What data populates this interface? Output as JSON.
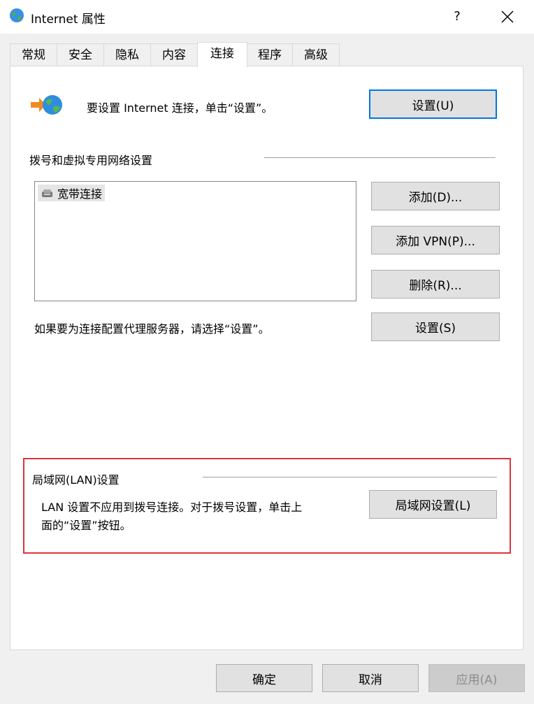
{
  "window": {
    "title": "Internet 属性",
    "help_label": "?",
    "icon": "globe-icon",
    "close_icon": "close-icon"
  },
  "tabs": [
    {
      "label": "常规"
    },
    {
      "label": "安全"
    },
    {
      "label": "隐私"
    },
    {
      "label": "内容"
    },
    {
      "label": "连接"
    },
    {
      "label": "程序"
    },
    {
      "label": "高级"
    }
  ],
  "active_tab": "连接",
  "setup": {
    "icon": "network-connection-icon",
    "text": "要设置 Internet 连接，单击“设置”。",
    "button": "设置(U)"
  },
  "dialup": {
    "heading": "拨号和虚拟专用网络设置",
    "list": [
      {
        "label": "宽带连接",
        "icon": "broadband-icon"
      }
    ],
    "add_button": "添加(D)...",
    "add_vpn_button": "添加 VPN(P)...",
    "remove_button": "删除(R)...",
    "proxy_text": "如果要为连接配置代理服务器，请选择“设置”。",
    "settings_button": "设置(S)"
  },
  "lan": {
    "heading": "局域网(LAN)设置",
    "text_line1": "LAN 设置不应用到拨号连接。对于拨号设置，单击上",
    "text_line2": "面的“设置”按钮。",
    "button": "局域网设置(L)",
    "highlight_color": "#e0343b"
  },
  "footer": {
    "ok": "确定",
    "cancel": "取消",
    "apply": "应用(A)"
  },
  "colors": {
    "focus_border": "#0078d7",
    "window_bg": "#f0f0f0"
  }
}
